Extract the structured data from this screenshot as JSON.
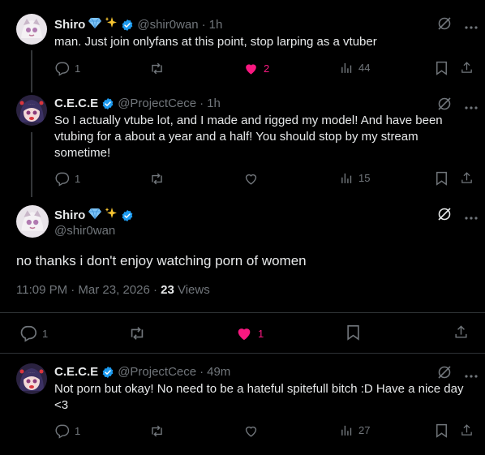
{
  "colors": {
    "accent_pink": "#f91880",
    "verified_blue": "#1d9bf0",
    "muted": "#71767b"
  },
  "post1": {
    "name": "Shiro",
    "handle": "@shir0wan",
    "time": "1h",
    "text": "man. Just join onlyfans at this point, stop larping as a vtuber",
    "replies": "1",
    "likes": "2",
    "views": "44"
  },
  "post2": {
    "name": "C.E.C.E",
    "handle": "@ProjectCece",
    "time": "1h",
    "text": "So I actually vtube lot, and I made and rigged my model! And have been vtubing for a about a year and a half! You should stop by my stream sometime!",
    "replies": "1",
    "views": "15"
  },
  "main": {
    "name": "Shiro",
    "handle": "@shir0wan",
    "text": "no thanks i don't enjoy watching porn of women",
    "timestamp": "11:09 PM · Mar 23, 2026 · ",
    "views_count": "23",
    "views_label": " Views",
    "replies": "1",
    "likes": "1"
  },
  "post4": {
    "name": "C.E.C.E",
    "handle": "@ProjectCece",
    "time": "49m",
    "text": "Not porn but okay! No need to be a hateful spitefull bitch :D Have a nice day <3",
    "replies": "1",
    "views": "27"
  },
  "separator": "·"
}
